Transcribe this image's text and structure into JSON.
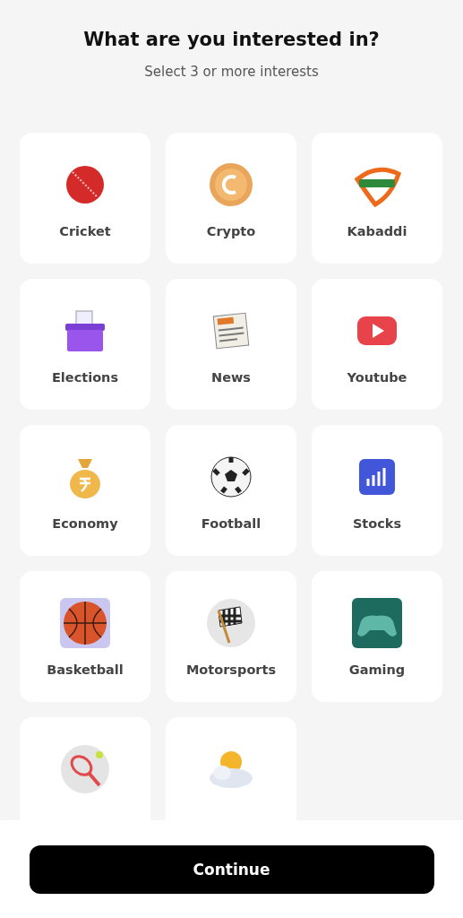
{
  "header": {
    "title": "What are you interested in?",
    "subtitle": "Select 3 or more interests"
  },
  "interests": [
    {
      "kind": "cricket",
      "label": "Cricket"
    },
    {
      "kind": "crypto",
      "label": "Crypto"
    },
    {
      "kind": "kabaddi",
      "label": "Kabaddi"
    },
    {
      "kind": "elections",
      "label": "Elections"
    },
    {
      "kind": "news",
      "label": "News"
    },
    {
      "kind": "video",
      "label": "Youtube"
    },
    {
      "kind": "economy",
      "label": "Economy"
    },
    {
      "kind": "football",
      "label": "Football"
    },
    {
      "kind": "stocks",
      "label": "Stocks"
    },
    {
      "kind": "basketball",
      "label": "Basketball"
    },
    {
      "kind": "motorsports",
      "label": "Motorsports"
    },
    {
      "kind": "gaming",
      "label": "Gaming"
    },
    {
      "kind": "tennis"
    },
    {
      "kind": "weather"
    }
  ],
  "continue_button": "Continue"
}
